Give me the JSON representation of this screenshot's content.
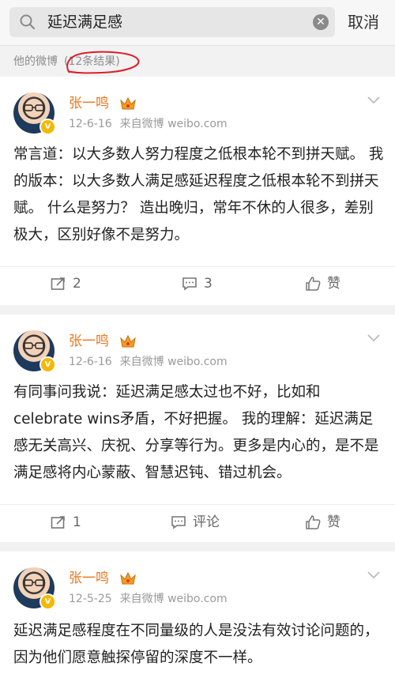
{
  "search": {
    "query": "延迟满足感",
    "cancel_label": "取消"
  },
  "results": {
    "label": "他的微博",
    "count": "(12条结果)"
  },
  "posts": [
    {
      "author": "张一鸣",
      "date": "12-6-16",
      "source": "来自微博 weibo.com",
      "text": "常言道：以大多数人努力程度之低根本轮不到拼天赋。 我的版本：以大多数人满足感延迟程度之低根本轮不到拼天赋。 什么是努力？ 造出晚归，常年不休的人很多，差别极大，区别好像不是努力。",
      "repost": "2",
      "comment": "3",
      "like": "赞"
    },
    {
      "author": "张一鸣",
      "date": "12-6-16",
      "source": "来自微博 weibo.com",
      "text": "有同事问我说：延迟满足感太过也不好，比如和celebrate wins矛盾，不好把握。 我的理解：延迟满足感无关高兴、庆祝、分享等行为。更多是内心的，是不是满足感将内心蒙蔽、智慧迟钝、错过机会。",
      "repost": "1",
      "comment": "评论",
      "like": "赞"
    },
    {
      "author": "张一鸣",
      "date": "12-5-25",
      "source": "来自微博 weibo.com",
      "text": "延迟满足感程度在不同量级的人是没法有效讨论问题的，因为他们愿意触探停留的深度不一样。"
    }
  ]
}
